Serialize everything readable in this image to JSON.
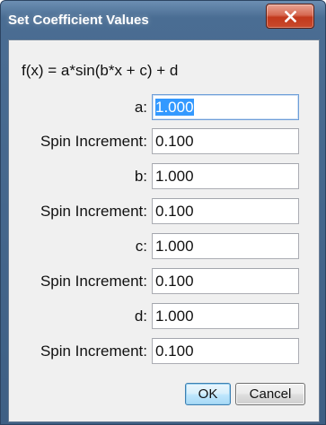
{
  "window": {
    "title": "Set Coefficient Values"
  },
  "formula": "f(x) = a*sin(b*x + c) + d",
  "fields": [
    {
      "label": "a:",
      "value": "1.000"
    },
    {
      "label": "Spin Increment:",
      "value": "0.100"
    },
    {
      "label": "b:",
      "value": "1.000"
    },
    {
      "label": "Spin Increment:",
      "value": "0.100"
    },
    {
      "label": "c:",
      "value": "1.000"
    },
    {
      "label": "Spin Increment:",
      "value": "0.100"
    },
    {
      "label": "d:",
      "value": "1.000"
    },
    {
      "label": "Spin Increment:",
      "value": "0.100"
    }
  ],
  "buttons": {
    "ok": "OK",
    "cancel": "Cancel"
  },
  "colors": {
    "selection": "#3399ff",
    "focus_border": "#6e9ed8",
    "title_bar": "#4a6d93",
    "close_button": "#c2391d"
  },
  "icons": {
    "close": "close-icon"
  }
}
